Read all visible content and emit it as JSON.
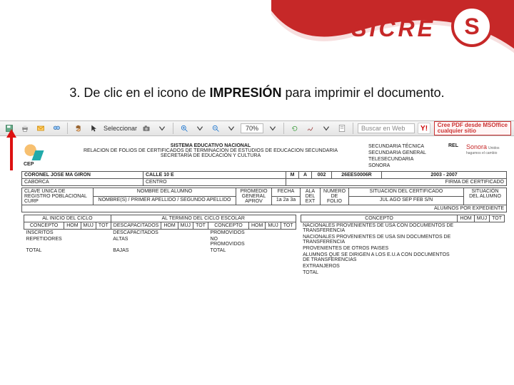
{
  "brand": {
    "name": "SICRE",
    "badge": "S"
  },
  "instruction": {
    "prefix": "3. De clic en el icono de ",
    "bold": "IMPRESIÓN",
    "suffix": " para imprimir el documento."
  },
  "toolbar": {
    "select_label": "Seleccionar",
    "zoom_value": "70%",
    "search_placeholder": "Buscar en Web",
    "yahoo": "Y!",
    "pdf_ad_line1": "Cree PDF desde MSOffice",
    "pdf_ad_line2": "cualquier sitio"
  },
  "doc": {
    "system_title": "SISTEMA EDUCATIVO NACIONAL",
    "subtitle": "RELACION DE FOLIOS DE CERTIFICADOS DE TERMINACION DE ESTUDIOS DE EDUCACION SECUNDARIA",
    "secretaria": "SECRETARÍA DE EDUCACIÓN Y CULTURA",
    "cep": "CEP",
    "right_labels": {
      "sec_tecnica": "SECUNDARIA TÉCNICA",
      "sec_general": "SECUNDARIA GENERAL",
      "tele": "TELESECUNDARIA",
      "sonora": "SONORA"
    },
    "rel": "REL",
    "sonora_brand": "Sonora",
    "sonora_tag": "Unidos hagamos el cambio",
    "row1": {
      "name": "CORONEL JOSE MA GIRON",
      "calle": "CALLE 10 E",
      "m": "M",
      "a": "A",
      "code": "002",
      "clave": "26EES0006R",
      "period": "2003 - 2007"
    },
    "row2": {
      "caborca": "CABORCA",
      "centro": "CENTRO",
      "cert_label": "FIRMA DE CERTIFICADO"
    },
    "band_headers": {
      "curp1": "CLAVE UNICA DE",
      "curp2": "REGISTRO POBLACIONAL",
      "curp3": "CURP",
      "nombre": "NOMBRE DEL ALUMNO",
      "nombre_sub": "NOMBRE(S) / PRIMER APELLIDO / SEGUNDO APELLIDO",
      "prom1": "PROMEDIO",
      "prom2": "GENERAL",
      "prom3": "APROV",
      "fecha": "FECHA",
      "fecha_sub": "1a  2a  3a",
      "ala1": "ALA",
      "ala2": "DEL",
      "ala3": "EXT",
      "numero": "NUMERO",
      "numero2": "DE",
      "numero3": "FOLIO",
      "sit": "SITUACION DEL CERTIFICADO",
      "sit_sub": "JUL  AGO  SEP  FEB  S/N",
      "alumnos": "ALUMNOS POR EXPEDIENTE",
      "situ_alumno1": "SITUACIÓN",
      "situ_alumno2": "DEL ALUMNO"
    },
    "left_block": {
      "al_inicio": "AL INICIO DEL CICLO",
      "al_termino": "AL TERMINO DEL CICLO ESCOLAR",
      "cols_inicio": [
        "CONCEPTO",
        "HOM",
        "MUJ",
        "TOT"
      ],
      "cols_term": [
        "DESCAPACITADOS",
        "HOM",
        "MUJ",
        "TOT",
        "CONCEPTO",
        "HOM",
        "MUJ",
        "TOT"
      ],
      "rows_inicio": [
        "INSCRITOS",
        "REPETIDORES",
        "TOTAL"
      ],
      "rows_term_left": [
        "DESCAPACITADOS",
        "ALTAS",
        "BAJAS"
      ],
      "rows_term_right": [
        "PROMOVIDOS",
        "NO PROMOVIDOS",
        "TOTAL"
      ]
    },
    "right_block": {
      "header": [
        "CONCEPTO",
        "HOM",
        "MUJ",
        "TOT"
      ],
      "rows": [
        "NACIONALES PROVENIENTES DE USA CON DOCUMENTOS DE TRANSFERENCIA",
        "NACIONALES PROVENIENTES DE USA SIN DOCUMENTOS DE TRANSFERENCIA",
        "PROVENIENTES DE OTROS PAISES",
        "ALUMNOS QUE SE DIRIGEN A LOS E.U.A CON DOCUMENTOS DE TRANSFERENCIAS",
        "EXTRANJEROS",
        "TOTAL"
      ]
    }
  }
}
